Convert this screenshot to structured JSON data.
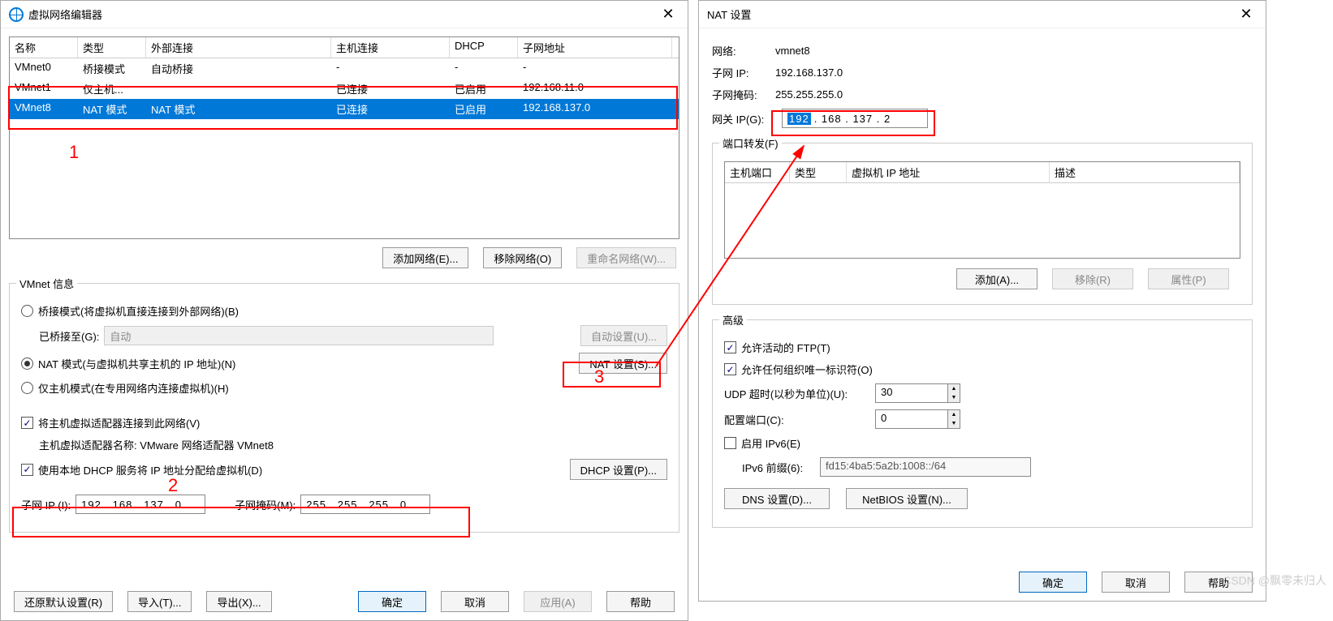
{
  "left": {
    "title": "虚拟网络编辑器",
    "headers": {
      "name": "名称",
      "type": "类型",
      "ext": "外部连接",
      "host": "主机连接",
      "dhcp": "DHCP",
      "sub": "子网地址"
    },
    "rows": [
      {
        "name": "VMnet0",
        "type": "桥接模式",
        "ext": "自动桥接",
        "host": "-",
        "dhcp": "-",
        "sub": "-",
        "sel": false
      },
      {
        "name": "VMnet1",
        "type": "仅主机...",
        "ext": "",
        "host": "已连接",
        "dhcp": "已启用",
        "sub": "192.168.11.0",
        "sel": false
      },
      {
        "name": "VMnet8",
        "type": "NAT 模式",
        "ext": "NAT 模式",
        "host": "已连接",
        "dhcp": "已启用",
        "sub": "192.168.137.0",
        "sel": true
      }
    ],
    "btns": {
      "add": "添加网络(E)...",
      "remove": "移除网络(O)",
      "rename": "重命名网络(W)..."
    },
    "group_title": "VMnet 信息",
    "radio_bridge": "桥接模式(将虚拟机直接连接到外部网络)(B)",
    "bridge_to_label": "已桥接至(G):",
    "bridge_to_val": "自动",
    "bridge_auto_btn": "自动设置(U)...",
    "radio_nat": "NAT 模式(与虚拟机共享主机的 IP 地址)(N)",
    "nat_btn": "NAT 设置(S)...",
    "radio_host": "仅主机模式(在专用网络内连接虚拟机)(H)",
    "chk_hostadapter": "将主机虚拟适配器连接到此网络(V)",
    "hostadapter_name": "主机虚拟适配器名称: VMware 网络适配器 VMnet8",
    "chk_dhcp": "使用本地 DHCP 服务将 IP 地址分配给虚拟机(D)",
    "dhcp_btn": "DHCP 设置(P)...",
    "subnet_ip_label": "子网 IP (I):",
    "subnet_ip": "192 . 168 . 137 .  0",
    "subnet_mask_label": "子网掩码(M):",
    "subnet_mask": "255 . 255 . 255 .  0",
    "restore": "还原默认设置(R)",
    "import": "导入(T)...",
    "export": "导出(X)...",
    "ok": "确定",
    "cancel": "取消",
    "apply": "应用(A)",
    "help": "帮助",
    "ann1": "1",
    "ann2": "2",
    "ann3": "3"
  },
  "right": {
    "title": "NAT 设置",
    "net_label": "网络:",
    "net_val": "vmnet8",
    "subip_label": "子网 IP:",
    "subip_val": "192.168.137.0",
    "submask_label": "子网掩码:",
    "submask_val": "255.255.255.0",
    "gw_label": "网关 IP(G):",
    "gw_oct1": "192",
    "gw_rest": ". 168 . 137 .  2",
    "fwd_title": "端口转发(F)",
    "fwd_headers": {
      "host": "主机端口",
      "type": "类型",
      "vm": "虚拟机 IP 地址",
      "desc": "描述"
    },
    "add": "添加(A)...",
    "remove": "移除(R)",
    "prop": "属性(P)",
    "adv_title": "高级",
    "chk_ftp": "允许活动的 FTP(T)",
    "chk_org": "允许任何组织唯一标识符(O)",
    "udp_label": "UDP 超时(以秒为单位)(U):",
    "udp_val": "30",
    "port_label": "配置端口(C):",
    "port_val": "0",
    "chk_ipv6": "启用 IPv6(E)",
    "ipv6_label": "IPv6 前缀(6):",
    "ipv6_val": "fd15:4ba5:5a2b:1008::/64",
    "dns_btn": "DNS 设置(D)...",
    "netbios_btn": "NetBIOS 设置(N)...",
    "ok": "确定",
    "cancel": "取消",
    "help": "帮助"
  },
  "watermark": "CSDN @飘零未归人"
}
